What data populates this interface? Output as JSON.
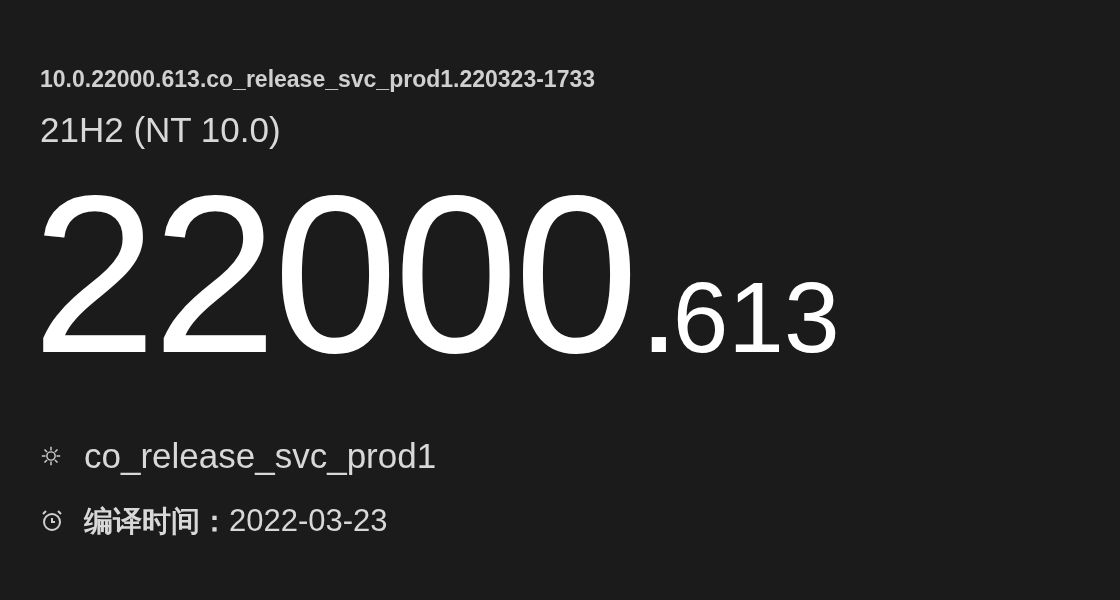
{
  "full_build": "10.0.22000.613.co_release_svc_prod1.220323-1733",
  "version": "21H2 (NT 10.0)",
  "build": {
    "major": "22000",
    "separator": ".",
    "minor": "613"
  },
  "branch": "co_release_svc_prod1",
  "compile": {
    "label": "编译时间：",
    "value": "2022-03-23"
  }
}
